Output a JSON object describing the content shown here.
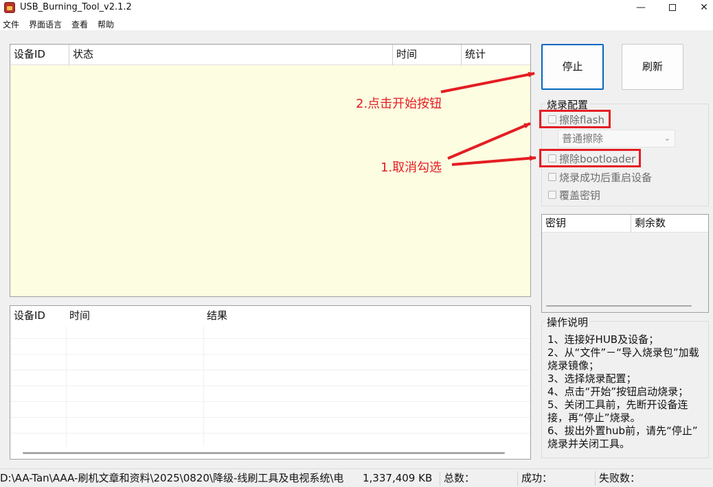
{
  "window": {
    "title": "USB_Burning_Tool_v2.1.2",
    "minimize": "—",
    "close": "✕"
  },
  "menu": [
    "文件",
    "界面语言",
    "查看",
    "帮助"
  ],
  "device_list": {
    "columns": [
      "设备ID",
      "状态",
      "时间",
      "统计"
    ]
  },
  "result_list": {
    "columns": [
      "设备ID",
      "时间",
      "结果"
    ]
  },
  "buttons": {
    "stop": "停止",
    "refresh": "刷新"
  },
  "burn_config": {
    "title": "烧录配置",
    "erase_flash": "擦除flash",
    "erase_mode": "普通擦除",
    "erase_bootloader": "擦除bootloader",
    "reboot_after": "烧录成功后重启设备",
    "overwrite_key": "覆盖密钥"
  },
  "key_list": {
    "columns": [
      "密钥",
      "剩余数"
    ]
  },
  "instructions": {
    "title": "操作说明",
    "lines": [
      "1、连接好HUB及设备；",
      "2、从“文件”－“导入烧录包”加载",
      "烧录镜像；",
      "3、选择烧录配置；",
      "4、点击“开始”按钮启动烧录；",
      "5、关闭工具前，先断开设备连",
      "接，再“停止”烧录。",
      "6、拔出外置hub前，请先“停止”",
      "烧录并关闭工具。"
    ]
  },
  "annotations": {
    "step2": "2.点击开始按钮",
    "step1": "1.取消勾选"
  },
  "status_bar": {
    "path": "D:\\AA-Tan\\AAA-刷机文章和资料\\2025\\0820\\降级-线刷工具及电视系统\\电",
    "size": "1,337,409 KB",
    "total": "总数：",
    "success": "成功：",
    "failed": "失败数："
  },
  "colors": {
    "annotation": "#e41d23",
    "device_list_bg": "#fdfde1",
    "focus_border": "#0067c0"
  }
}
